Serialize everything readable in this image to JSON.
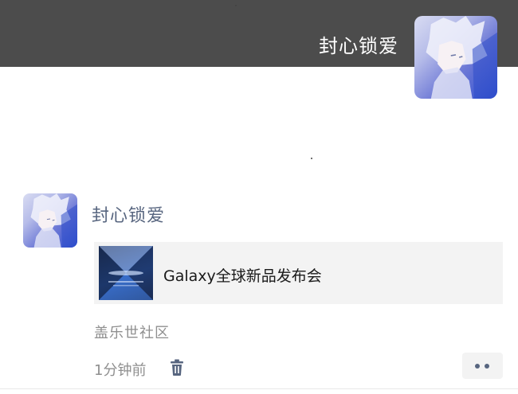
{
  "cover": {
    "user_name": "封心锁爱",
    "background_color": "#4c4c4c",
    "avatar_icon": "anime-avatar"
  },
  "post": {
    "author_name": "封心锁爱",
    "avatar_icon": "anime-avatar",
    "link_card": {
      "title": "Galaxy全球新品发布会",
      "thumbnail_icon": "galaxy-event-thumbnail"
    },
    "location": "盖乐世社区",
    "timestamp": "1分钟前",
    "actions": {
      "delete_icon": "trash-icon",
      "more_icon": "more-dots-icon"
    }
  },
  "colors": {
    "name_blue": "#57657f",
    "meta_gray": "#8f8f8f",
    "card_bg": "#f3f3f3"
  }
}
